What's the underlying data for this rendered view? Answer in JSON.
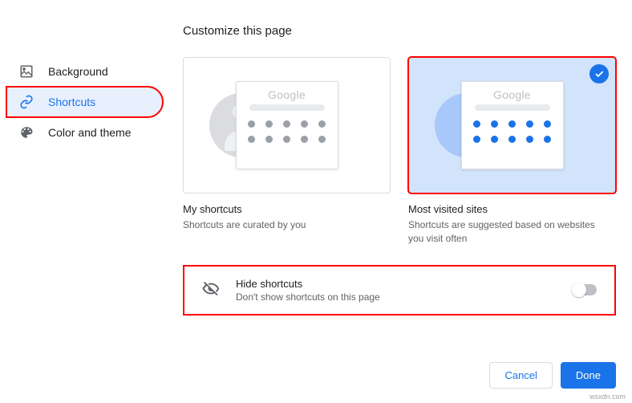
{
  "page": {
    "title": "Customize this page"
  },
  "sidebar": {
    "items": [
      {
        "label": "Background"
      },
      {
        "label": "Shortcuts"
      },
      {
        "label": "Color and theme"
      }
    ],
    "active_index": 1
  },
  "cards": {
    "my_shortcuts": {
      "title": "My shortcuts",
      "description": "Shortcuts are curated by you",
      "preview_logo": "Google",
      "dot_color": "grey",
      "selected": false
    },
    "most_visited": {
      "title": "Most visited sites",
      "description": "Shortcuts are suggested based on websites you visit often",
      "preview_logo": "Google",
      "dot_color": "blue",
      "selected": true
    }
  },
  "hide": {
    "title": "Hide shortcuts",
    "description": "Don't show shortcuts on this page",
    "enabled": false
  },
  "footer": {
    "cancel": "Cancel",
    "done": "Done"
  },
  "watermark": "wsxdn.com"
}
